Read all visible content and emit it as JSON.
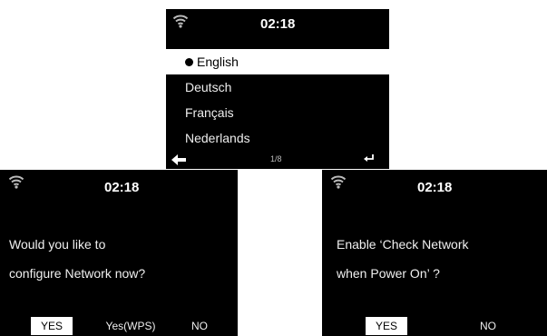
{
  "language_screen": {
    "time": "02:18",
    "languages": [
      {
        "label": "English",
        "selected": true
      },
      {
        "label": "Deutsch",
        "selected": false
      },
      {
        "label": "Français",
        "selected": false
      },
      {
        "label": "Nederlands",
        "selected": false
      }
    ],
    "page": "1/8",
    "back_icon": "arrow-left-icon",
    "enter_icon": "enter-icon"
  },
  "network_screen": {
    "time": "02:18",
    "question_line1": "Would you like to",
    "question_line2": "configure Network now?",
    "btn_yes": "YES",
    "btn_wps": "Yes(WPS)",
    "btn_no": "NO"
  },
  "check_screen": {
    "time": "02:18",
    "question_line1": "Enable ‘Check Network",
    "question_line2": "when Power On’ ?",
    "btn_yes": "YES",
    "btn_no": "NO"
  },
  "colors": {
    "screen_bg": "#000000",
    "highlight": "#ffffff"
  },
  "icons": {
    "status": "wifi-icon"
  }
}
